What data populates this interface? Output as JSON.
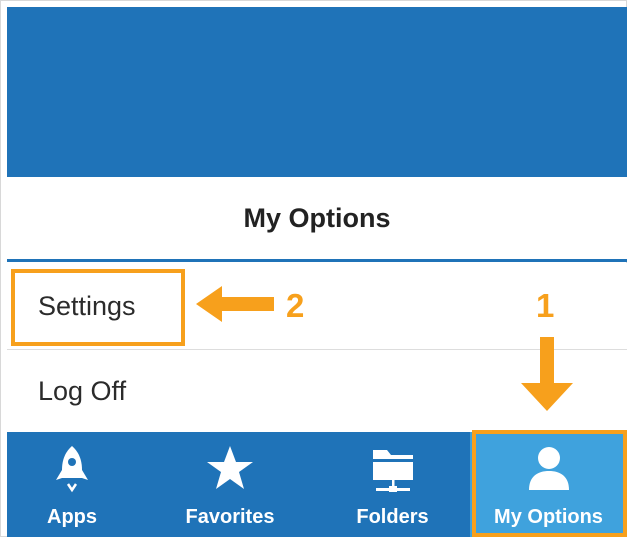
{
  "header": {
    "title": "My Options"
  },
  "menu": {
    "items": [
      {
        "label": "Settings"
      },
      {
        "label": "Log Off"
      }
    ]
  },
  "annotations": {
    "step_1": "1",
    "step_2": "2",
    "highlight_color": "#f7a01c"
  },
  "tabbar": {
    "tabs": [
      {
        "label": "Apps",
        "icon": "rocket-icon"
      },
      {
        "label": "Favorites",
        "icon": "star-icon"
      },
      {
        "label": "Folders",
        "icon": "folder-network-icon"
      },
      {
        "label": "My Options",
        "icon": "user-icon",
        "active": true
      }
    ],
    "background_color": "#1f73b8",
    "active_color": "#3fa2dd"
  }
}
